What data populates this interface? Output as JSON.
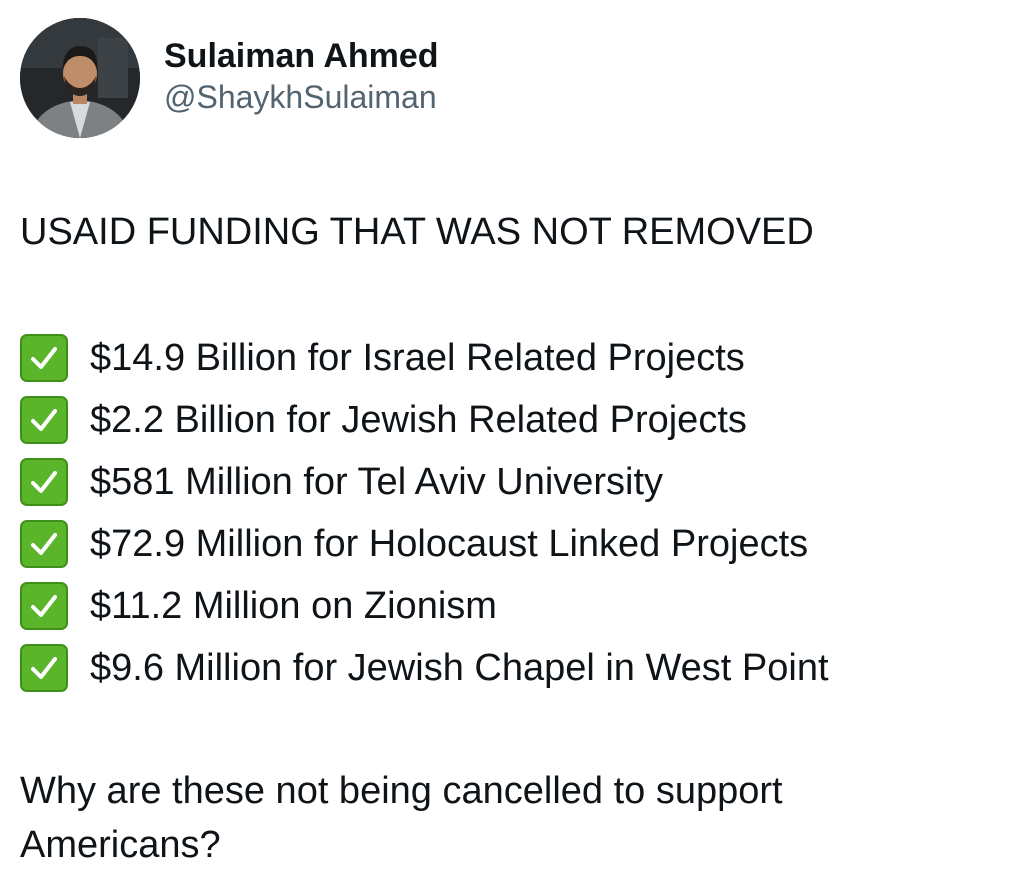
{
  "author": {
    "display_name": "Sulaiman Ahmed",
    "handle": "@ShaykhSulaiman",
    "avatar_icon": "profile-photo"
  },
  "post": {
    "headline": "USAID FUNDING THAT WAS NOT REMOVED",
    "items": [
      {
        "icon": "green-checkmark-icon",
        "text": "$14.9 Billion for Israel Related Projects"
      },
      {
        "icon": "green-checkmark-icon",
        "text": "$2.2 Billion for Jewish Related Projects"
      },
      {
        "icon": "green-checkmark-icon",
        "text": "$581 Million for Tel Aviv University"
      },
      {
        "icon": "green-checkmark-icon",
        "text": "$72.9 Million for Holocaust Linked Projects"
      },
      {
        "icon": "green-checkmark-icon",
        "text": "$11.2 Million on Zionism"
      },
      {
        "icon": "green-checkmark-icon",
        "text": "$9.6 Million for Jewish Chapel in West Point"
      }
    ],
    "question": "Why are these not being cancelled to support Americans?"
  },
  "colors": {
    "text": "#0f1419",
    "handle": "#536471",
    "check_green": "#5ab52a"
  }
}
